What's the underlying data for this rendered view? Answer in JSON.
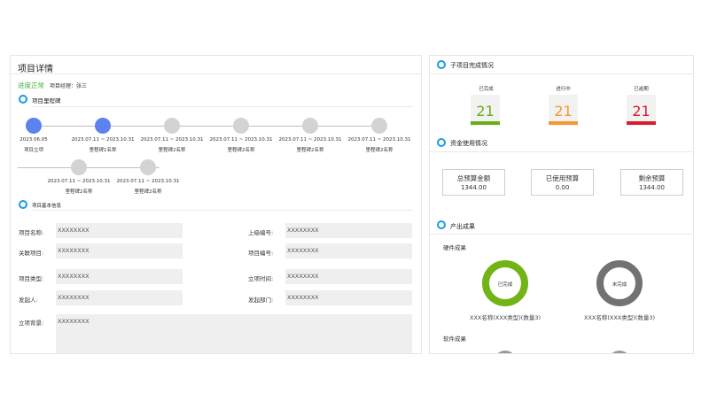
{
  "left": {
    "title": "项目详情",
    "progress_status": "进度正常",
    "manager_label": "项目经理：",
    "manager_name": "张三",
    "milestone_section": "项目里程碑",
    "milestones_row1": [
      {
        "date": "2023.06.05",
        "name": "项目立项",
        "active": true
      },
      {
        "date": "2023.07.11 ~ 2023.10.31",
        "name": "里程碑1名称",
        "active": true
      },
      {
        "date": "2023.07.11 ~ 2023.10.31",
        "name": "里程碑2名称",
        "active": false
      },
      {
        "date": "2023.07.11 ~ 2023.10.31",
        "name": "里程碑2名称",
        "active": false
      },
      {
        "date": "2023.07.11 ~ 2023.10.31",
        "name": "里程碑2名称",
        "active": false
      },
      {
        "date": "2023.07.11 ~ 2023.10.31",
        "name": "里程碑2名称",
        "active": false
      }
    ],
    "milestones_row2": [
      {
        "date": "2023.07.11 ~ 2023.10.31",
        "name": "里程碑2名称",
        "active": false
      },
      {
        "date": "2023.07.11 ~ 2023.10.31",
        "name": "里程碑2名称",
        "active": false
      }
    ],
    "basic_section": "项目基本信息",
    "fields": {
      "project_name": {
        "label": "项目名称:",
        "value": "XXXXXXXX"
      },
      "parent_code": {
        "label": "上级编号:",
        "value": "XXXXXXXX"
      },
      "related_project": {
        "label": "关联项目:",
        "value": "XXXXXXXX"
      },
      "project_code": {
        "label": "项目编号:",
        "value": "XXXXXXXX"
      },
      "project_type": {
        "label": "项目类型:",
        "value": "XXXXXXXX"
      },
      "setup_time": {
        "label": "立项时间:",
        "value": "XXXXXXXX"
      },
      "initiator": {
        "label": "发起人:",
        "value": "XXXXXXXX"
      },
      "initiating_dept": {
        "label": "发起部门:",
        "value": "XXXXXXXX"
      },
      "background": {
        "label": "立项背景:",
        "value": "XXXXXXXX"
      }
    }
  },
  "right": {
    "sub_section": "子项目完成情况",
    "stats": [
      {
        "label": "已完成",
        "value": "21",
        "color": "#67ae19"
      },
      {
        "label": "进行中",
        "value": "21",
        "color": "#f39a2d"
      },
      {
        "label": "已逾期",
        "value": "21",
        "color": "#d71d2e"
      }
    ],
    "fund_section": "资金使用情况",
    "budgets": [
      {
        "label": "总预算金额",
        "value": "1344.00"
      },
      {
        "label": "已使用预算",
        "value": "0.00"
      },
      {
        "label": "剩余预算",
        "value": "1344.00"
      }
    ],
    "output_section": "产出成果",
    "hardware_label": "硬件成果",
    "hardware_items": [
      {
        "status": "已完成",
        "name": "XXX名称(XXX类型)(数量3)",
        "color": "#72b316"
      },
      {
        "status": "未完成",
        "name": "XXX名称(XXX类型)(数量3)",
        "color": "#727272"
      }
    ],
    "software_label": "软件成果"
  }
}
